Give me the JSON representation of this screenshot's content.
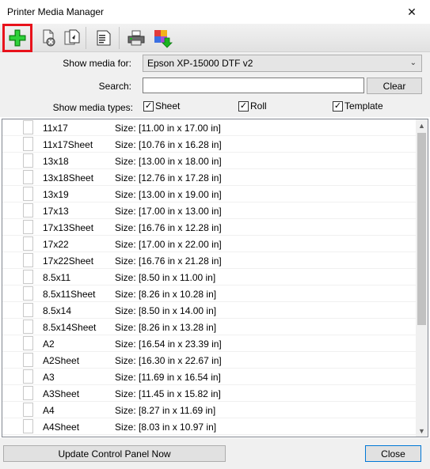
{
  "window": {
    "title": "Printer Media Manager",
    "close_glyph": "✕"
  },
  "toolbar": {
    "buttons": [
      {
        "icon": "add-media-icon",
        "color": "#1bb321"
      },
      {
        "icon": "delete-media-icon"
      },
      {
        "icon": "copy-media-icon"
      },
      {
        "icon": "edit-media-icon"
      },
      {
        "icon": "printer-settings-icon"
      },
      {
        "icon": "import-media-icon"
      }
    ]
  },
  "filters": {
    "show_media_for_label": "Show media for:",
    "printer_selected": "Epson XP-15000 DTF v2",
    "search_label": "Search:",
    "search_value": "",
    "clear_label": "Clear",
    "show_types_label": "Show media types:",
    "types": [
      {
        "label": "Sheet",
        "checked": true
      },
      {
        "label": "Roll",
        "checked": true
      },
      {
        "label": "Template",
        "checked": true
      }
    ]
  },
  "media": [
    {
      "name": "11x17",
      "size": "Size: [11.00 in x 17.00 in]"
    },
    {
      "name": "11x17Sheet",
      "size": "Size: [10.76 in x 16.28 in]"
    },
    {
      "name": "13x18",
      "size": "Size: [13.00 in x 18.00 in]"
    },
    {
      "name": "13x18Sheet",
      "size": "Size: [12.76 in x 17.28 in]"
    },
    {
      "name": "13x19",
      "size": "Size: [13.00 in x 19.00 in]"
    },
    {
      "name": "17x13",
      "size": "Size: [17.00 in x 13.00 in]"
    },
    {
      "name": "17x13Sheet",
      "size": "Size: [16.76 in x 12.28 in]"
    },
    {
      "name": "17x22",
      "size": "Size: [17.00 in x 22.00 in]"
    },
    {
      "name": "17x22Sheet",
      "size": "Size: [16.76 in x 21.28 in]"
    },
    {
      "name": "8.5x11",
      "size": "Size: [8.50 in x 11.00 in]"
    },
    {
      "name": "8.5x11Sheet",
      "size": "Size: [8.26 in x 10.28 in]"
    },
    {
      "name": "8.5x14",
      "size": "Size: [8.50 in x 14.00 in]"
    },
    {
      "name": "8.5x14Sheet",
      "size": "Size: [8.26 in x 13.28 in]"
    },
    {
      "name": "A2",
      "size": "Size: [16.54 in x 23.39 in]"
    },
    {
      "name": "A2Sheet",
      "size": "Size: [16.30 in x 22.67 in]"
    },
    {
      "name": "A3",
      "size": "Size: [11.69 in x 16.54 in]"
    },
    {
      "name": "A3Sheet",
      "size": "Size: [11.45 in x 15.82 in]"
    },
    {
      "name": "A4",
      "size": "Size: [8.27 in x 11.69 in]"
    },
    {
      "name": "A4Sheet",
      "size": "Size: [8.03 in x 10.97 in]"
    }
  ],
  "footer": {
    "update_label": "Update Control Panel Now",
    "close_label": "Close"
  }
}
